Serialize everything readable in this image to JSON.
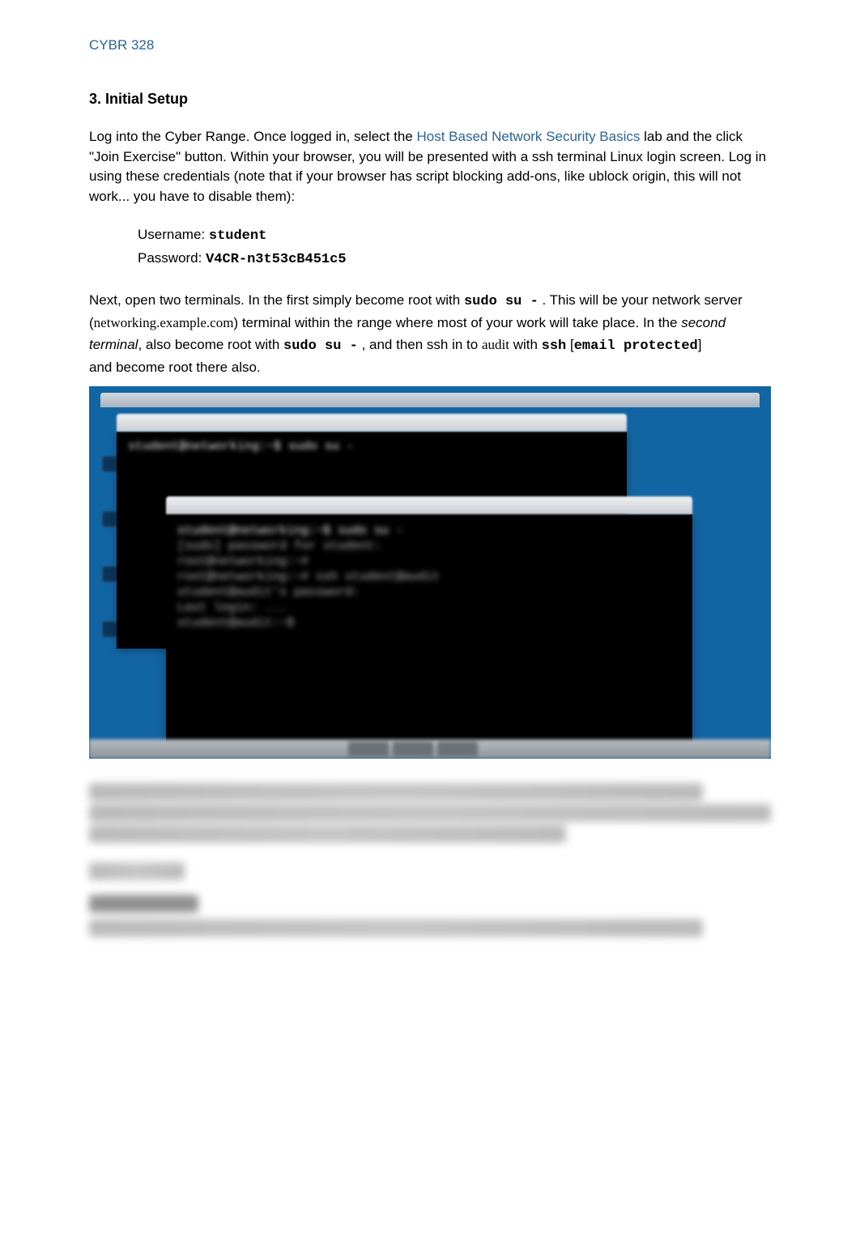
{
  "header": {
    "course_code": "CYBR 328"
  },
  "section": {
    "title": "3. Initial Setup"
  },
  "intro": {
    "lead": "Log into the Cyber Range. Once logged in, select the ",
    "lab_link": "Host Based Network Security Basics",
    "tail": " lab and the click \"Join Exercise\" button.  Within your browser, you will be presented with a ssh terminal Linux login screen. Log in using these credentials (note that if your browser has script blocking add-ons, like ublock origin, this will not work... you have to disable them):"
  },
  "credentials": {
    "username_label": "Username: ",
    "username_value": "student",
    "password_label": "Password: ",
    "password_value": "V4CR-n3t53cB451c5"
  },
  "steps": {
    "p1_a": "Next, open two terminals. In the first simply become root with ",
    "cmd1": "sudo su -",
    "p1_b": " . This will be your network server (",
    "host1": "networking.example.com",
    "p1_c": ") terminal within the range where most of your work will take place. In the ",
    "italic1": "second terminal",
    "p1_d": ", also become root with ",
    "cmd2": "sudo su -",
    "p1_e": " , and then ssh in to ",
    "host2": "audit",
    "p1_f": " with ",
    "cmd3": "ssh",
    "email_open": "[",
    "email_text": "email protected",
    "email_close": "]",
    "p1_g": " and become root there also."
  },
  "terminal": {
    "line1": "student@networking:~$ sudo su -",
    "line2": "[sudo] password for student:",
    "line3": "root@networking:~#",
    "line4": "root@networking:~# ssh student@audit",
    "line5": "student@audit's password:",
    "line6": "Last login: ...",
    "line7": "student@audit:~$"
  }
}
